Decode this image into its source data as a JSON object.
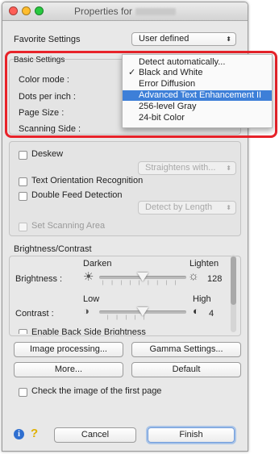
{
  "window": {
    "title": "Properties for"
  },
  "favorite": {
    "label": "Favorite Settings",
    "value": "User defined"
  },
  "basic": {
    "title": "Basic Settings",
    "color_mode_label": "Color mode :",
    "dpi_label": "Dots per inch :",
    "page_size_label": "Page Size :",
    "scanning_side_label": "Scanning Side :"
  },
  "color_menu": {
    "items": [
      {
        "label": "Detect automatically...",
        "checked": false,
        "highlighted": false
      },
      {
        "label": "Black and White",
        "checked": true,
        "highlighted": false
      },
      {
        "label": "Error Diffusion",
        "checked": false,
        "highlighted": false
      },
      {
        "label": "Advanced Text Enhancement II",
        "checked": false,
        "highlighted": true
      },
      {
        "label": "256-level Gray",
        "checked": false,
        "highlighted": false
      },
      {
        "label": "24-bit Color",
        "checked": false,
        "highlighted": false
      }
    ],
    "check_glyph": "✓"
  },
  "options": {
    "deskew_label": "Deskew",
    "deskew_popup": "Straightens with...",
    "text_orientation_label": "Text Orientation Recognition",
    "double_feed_label": "Double Feed Detection",
    "double_feed_popup": "Detect by Length",
    "set_area_label": "Set Scanning Area"
  },
  "bc": {
    "title": "Brightness/Contrast",
    "darken": "Darken",
    "lighten": "Lighten",
    "brightness_label": "Brightness :",
    "brightness_value": "128",
    "low": "Low",
    "high": "High",
    "contrast_label": "Contrast :",
    "contrast_value": "4",
    "back_side_label": "Enable Back Side Brightness"
  },
  "buttons": {
    "image_processing": "Image processing...",
    "gamma": "Gamma Settings...",
    "more": "More...",
    "default": "Default",
    "cancel": "Cancel",
    "finish": "Finish"
  },
  "check_first_page_label": "Check the image of the first page",
  "colors": {
    "highlight": "#3d7fd8",
    "callout": "#e8232a",
    "info_icon": "#2f6fd0",
    "help_icon": "#e0b000"
  }
}
